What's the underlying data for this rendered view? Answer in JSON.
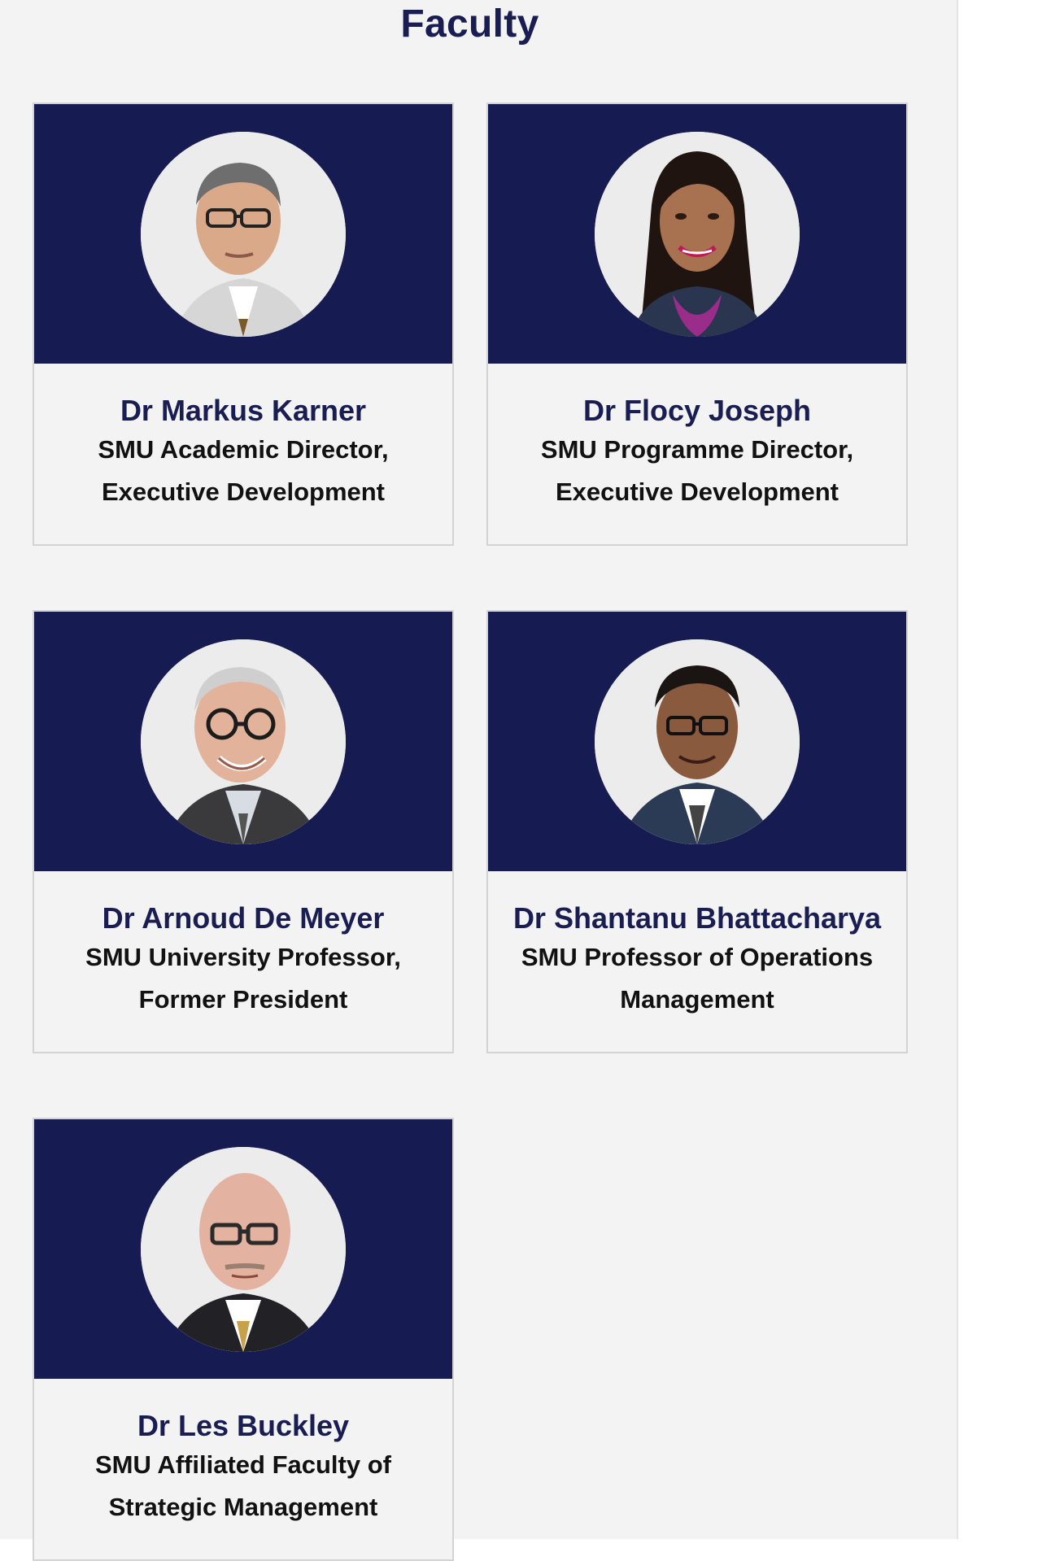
{
  "section": {
    "title": "Faculty"
  },
  "colors": {
    "band": "#161b51",
    "name": "#1a1d52",
    "panel": "#f3f3f3"
  },
  "faculty": [
    {
      "name": "Dr Markus Karner",
      "role_line1": "SMU Academic Director,",
      "role_line2": "Executive Development",
      "icon": "portrait-icon"
    },
    {
      "name": "Dr Flocy Joseph",
      "role_line1": "SMU Programme Director,",
      "role_line2": "Executive Development",
      "icon": "portrait-icon"
    },
    {
      "name": "Dr Arnoud De Meyer",
      "role_line1": "SMU University Professor,",
      "role_line2": "Former President",
      "icon": "portrait-icon"
    },
    {
      "name": "Dr Shantanu Bhattacharya",
      "role_line1": "SMU Professor of Operations",
      "role_line2": "Management",
      "icon": "portrait-icon"
    },
    {
      "name": "Dr Les Buckley",
      "role_line1": "SMU Affiliated Faculty of",
      "role_line2": "Strategic Management",
      "icon": "portrait-icon"
    }
  ]
}
